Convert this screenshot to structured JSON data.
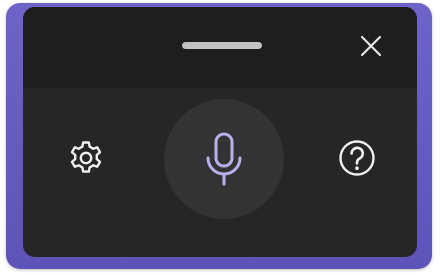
{
  "window": {
    "accent_color": "#6a5fc6",
    "panel_color": "#262626",
    "titlebar_color": "#1e1e1e"
  },
  "titlebar": {
    "drag_handle_icon": "drag-handle",
    "close_icon": "close-icon"
  },
  "controls": {
    "settings_icon": "gear-icon",
    "microphone_icon": "microphone-icon",
    "microphone_color": "#b8b0ee",
    "help_icon": "question-circle-icon"
  }
}
